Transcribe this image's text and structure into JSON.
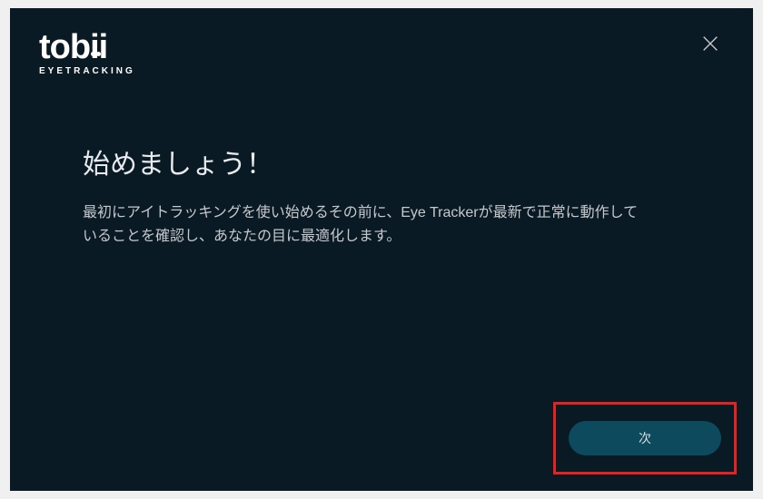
{
  "logo": {
    "text": "tobii",
    "subtitle": "EYETRACKING"
  },
  "content": {
    "title": "始めましょう！",
    "description": "最初にアイトラッキングを使い始めるその前に、Eye Trackerが最新で正常に動作していることを確認し、あなたの目に最適化します。"
  },
  "buttons": {
    "next_label": "次"
  }
}
